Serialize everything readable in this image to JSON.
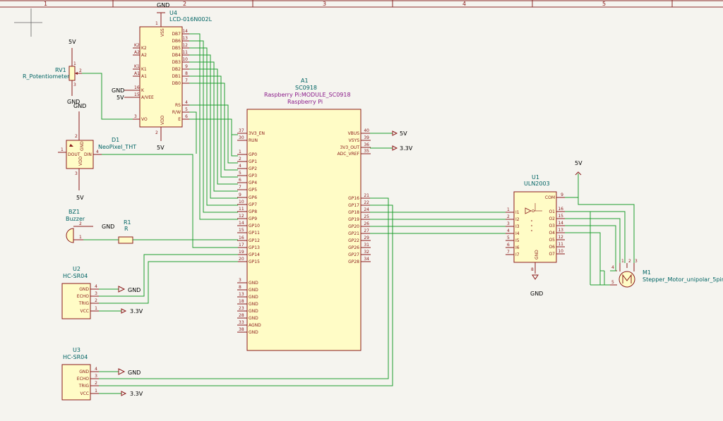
{
  "frame": {
    "columns": [
      "1",
      "2",
      "3",
      "4",
      "5"
    ]
  },
  "components": {
    "lcd": {
      "ref": "U4",
      "value": "LCD-016N002L",
      "left_pins": [
        {
          "name": "K2",
          "num": "K2"
        },
        {
          "name": "A2",
          "num": "A2"
        },
        {
          "name": "K1",
          "num": "K1"
        },
        {
          "name": "A1",
          "num": "A1"
        },
        {
          "name": "K",
          "num": "16"
        },
        {
          "name": "A/VEE",
          "num": "15"
        },
        {
          "name": "VO",
          "num": "3"
        }
      ],
      "right_pins": [
        {
          "name": "DB7",
          "num": "14"
        },
        {
          "name": "DB6",
          "num": "13"
        },
        {
          "name": "DB5",
          "num": "12"
        },
        {
          "name": "DB4",
          "num": "11"
        },
        {
          "name": "DB3",
          "num": "10"
        },
        {
          "name": "DB2",
          "num": "9"
        },
        {
          "name": "DB1",
          "num": "8"
        },
        {
          "name": "DB0",
          "num": "7"
        },
        {
          "name": "RS",
          "num": "4"
        },
        {
          "name": "R/W",
          "num": "5"
        },
        {
          "name": "E",
          "num": "6"
        }
      ],
      "top_pin": {
        "name": "VSS",
        "num": "1"
      },
      "bottom_pin": {
        "name": "VDD",
        "num": "2"
      }
    },
    "pot": {
      "ref": "RV1",
      "value": "R_Potentiometer",
      "pins": [
        "1",
        "2",
        "3"
      ]
    },
    "neopixel": {
      "ref": "D1",
      "value": "NeoPixel_THT",
      "pins": {
        "gnd": "GND",
        "dout": "DOUT",
        "din": "DIN",
        "vdd": "VDD"
      },
      "nums": {
        "gnd": "2",
        "dout": "1",
        "din": "4",
        "vdd": "3"
      }
    },
    "buzzer": {
      "ref": "BZ1",
      "value": "Buzzer",
      "nums": [
        "2",
        "1"
      ]
    },
    "resistor": {
      "ref": "R1",
      "value": "R"
    },
    "pico": {
      "ref": "A1",
      "value": "SC0918",
      "lib": "Raspberry Pi:MODULE_SC0918",
      "lib2": "Raspberry Pi",
      "left_pins": [
        {
          "name": "3V3_EN",
          "num": "37"
        },
        {
          "name": "RUN",
          "num": "30"
        },
        {
          "name": "GP0",
          "num": "1"
        },
        {
          "name": "GP1",
          "num": "2"
        },
        {
          "name": "GP2",
          "num": "4"
        },
        {
          "name": "GP3",
          "num": "5"
        },
        {
          "name": "GP4",
          "num": "6"
        },
        {
          "name": "GP5",
          "num": "7"
        },
        {
          "name": "GP6",
          "num": "9"
        },
        {
          "name": "GP7",
          "num": "10"
        },
        {
          "name": "GP8",
          "num": "11"
        },
        {
          "name": "GP9",
          "num": "12"
        },
        {
          "name": "GP10",
          "num": "14"
        },
        {
          "name": "GP11",
          "num": "15"
        },
        {
          "name": "GP12",
          "num": "16"
        },
        {
          "name": "GP13",
          "num": "17"
        },
        {
          "name": "GP14",
          "num": "19"
        },
        {
          "name": "GP15",
          "num": "20"
        },
        {
          "name": "GND",
          "num": "3"
        },
        {
          "name": "GND",
          "num": "8"
        },
        {
          "name": "GND",
          "num": "13"
        },
        {
          "name": "GND",
          "num": "18"
        },
        {
          "name": "GND",
          "num": "23"
        },
        {
          "name": "GND",
          "num": "28"
        },
        {
          "name": "AGND",
          "num": "33"
        },
        {
          "name": "GND",
          "num": "38"
        }
      ],
      "right_pins": [
        {
          "name": "VBUS",
          "num": "40"
        },
        {
          "name": "VSYS",
          "num": "39"
        },
        {
          "name": "3V3_OUT",
          "num": "36"
        },
        {
          "name": "ADC_VREF",
          "num": "35"
        },
        {
          "name": "GP16",
          "num": "21"
        },
        {
          "name": "GP17",
          "num": "22"
        },
        {
          "name": "GP18",
          "num": "24"
        },
        {
          "name": "GP19",
          "num": "25"
        },
        {
          "name": "GP20",
          "num": "26"
        },
        {
          "name": "GP21",
          "num": "27"
        },
        {
          "name": "GP22",
          "num": "29"
        },
        {
          "name": "GP26",
          "num": "31"
        },
        {
          "name": "GP27",
          "num": "32"
        },
        {
          "name": "GP28",
          "num": "34"
        }
      ]
    },
    "uln": {
      "ref": "U1",
      "value": "ULN2003",
      "left_pins": [
        {
          "name": "I1",
          "num": "1"
        },
        {
          "name": "I2",
          "num": "2"
        },
        {
          "name": "I3",
          "num": "3"
        },
        {
          "name": "I4",
          "num": "4"
        },
        {
          "name": "I5",
          "num": "5"
        },
        {
          "name": "I6",
          "num": "6"
        },
        {
          "name": "I7",
          "num": "7"
        }
      ],
      "right_pins": [
        {
          "name": "COM",
          "num": "9"
        },
        {
          "name": "O1",
          "num": "16"
        },
        {
          "name": "O2",
          "num": "15"
        },
        {
          "name": "O3",
          "num": "14"
        },
        {
          "name": "O4",
          "num": "13"
        },
        {
          "name": "O5",
          "num": "12"
        },
        {
          "name": "O6",
          "num": "11"
        },
        {
          "name": "O7",
          "num": "10"
        }
      ],
      "gnd": {
        "name": "GND",
        "num": "8"
      }
    },
    "sonar1": {
      "ref": "U2",
      "value": "HC-SR04",
      "pins": [
        {
          "name": "GND",
          "num": "4"
        },
        {
          "name": "ECHO",
          "num": "3"
        },
        {
          "name": "TRIG",
          "num": "2"
        },
        {
          "name": "VCC",
          "num": "1"
        }
      ]
    },
    "sonar2": {
      "ref": "U3",
      "value": "HC-SR04",
      "pins": [
        {
          "name": "GND",
          "num": "4"
        },
        {
          "name": "ECHO",
          "num": "3"
        },
        {
          "name": "TRIG",
          "num": "2"
        },
        {
          "name": "VCC",
          "num": "1"
        }
      ]
    },
    "motor": {
      "ref": "M1",
      "value": "Stepper_Motor_unipolar_5pin",
      "nums": [
        "1",
        "2",
        "3",
        "4",
        "5"
      ]
    }
  },
  "power_labels": {
    "gnd": "GND",
    "v5": "5V",
    "v33": "3.3V"
  }
}
